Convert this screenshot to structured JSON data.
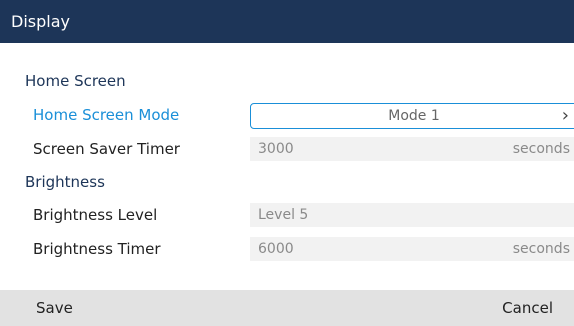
{
  "title": "Display",
  "sections": {
    "home_screen": "Home Screen",
    "brightness": "Brightness"
  },
  "fields": {
    "home_screen_mode": {
      "label": "Home Screen Mode",
      "value": "Mode 1",
      "icon": "chevron-right-icon"
    },
    "screen_saver_timer": {
      "label": "Screen Saver Timer",
      "value": "3000",
      "unit": "seconds"
    },
    "brightness_level": {
      "label": "Brightness Level",
      "value": "Level 5"
    },
    "brightness_timer": {
      "label": "Brightness Timer",
      "value": "6000",
      "unit": "seconds"
    }
  },
  "softkeys": {
    "save": "Save",
    "cancel": "Cancel"
  },
  "colors": {
    "titlebar": "#1d3558",
    "accent": "#1a8fd8",
    "softkey_bar": "#e2e2e2"
  }
}
